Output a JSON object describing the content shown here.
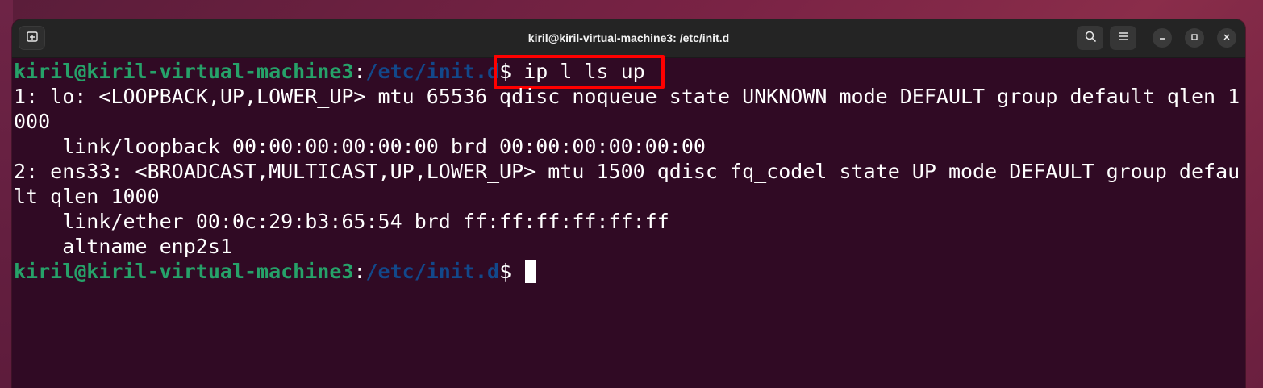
{
  "window": {
    "title": "kiril@kiril-virtual-machine3: /etc/init.d"
  },
  "titlebar": {
    "icons": {
      "new_tab": "new-tab-icon",
      "search": "search-icon",
      "menu": "hamburger-menu-icon",
      "minimize": "minimize-icon",
      "maximize": "maximize-icon",
      "close": "close-icon"
    }
  },
  "terminal": {
    "prompt": {
      "user_host": "kiril@kiril-virtual-machine3",
      "colon": ":",
      "path": "/etc/init.d",
      "dollar": "$"
    },
    "command": " ip l ls up",
    "output": [
      "1: lo: <LOOPBACK,UP,LOWER_UP> mtu 65536 qdisc noqueue state UNKNOWN mode DEFAULT group default qlen 1",
      "000",
      "    link/loopback 00:00:00:00:00:00 brd 00:00:00:00:00:00",
      "2: ens33: <BROADCAST,MULTICAST,UP,LOWER_UP> mtu 1500 qdisc fq_codel state UP mode DEFAULT group defau",
      "lt qlen 1000",
      "    link/ether 00:0c:29:b3:65:54 brd ff:ff:ff:ff:ff:ff",
      "    altname enp2s1"
    ],
    "second_prompt_trailing": " "
  },
  "colors": {
    "terminal_bg": "#300a24",
    "prompt_user": "#26a269",
    "prompt_path": "#12488b",
    "highlight": "#ff0000"
  }
}
